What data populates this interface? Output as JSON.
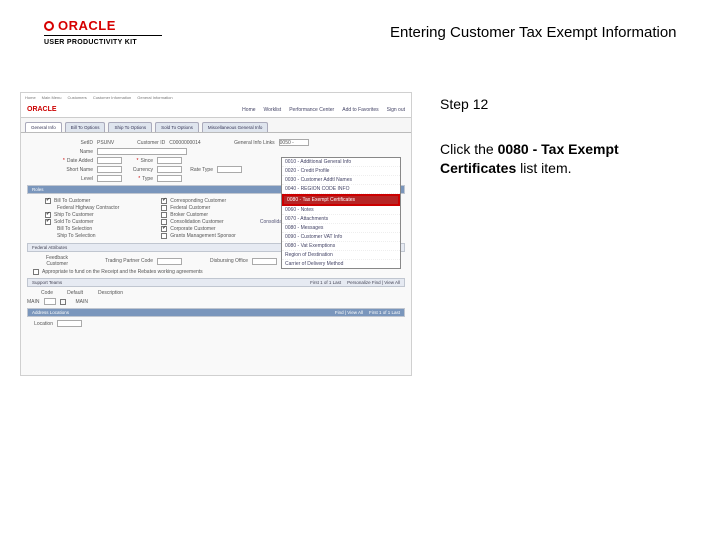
{
  "header": {
    "brand": "ORACLE",
    "subbrand": "USER PRODUCTIVITY KIT",
    "title": "Entering Customer Tax Exempt Information"
  },
  "instructions": {
    "step_label": "Step 12",
    "line_prefix": "Click the ",
    "line_bold": "0080 - Tax Exempt Certificates",
    "line_suffix": " list item."
  },
  "screenshot": {
    "nav_items": [
      "Home",
      "Main Menu",
      "Customers",
      "Customer Information",
      "General Information"
    ],
    "brand": "ORACLE",
    "top_menu": [
      "Home",
      "Worklist",
      "Performance Center",
      "Add to Favorites",
      "Sign out"
    ],
    "tabs": [
      "General Info",
      "Bill To Options",
      "Ship To Options",
      "Sold To Options",
      "Miscellaneous General Info"
    ],
    "fields": {
      "setid_label": "SetID",
      "setid_value": "PSUNV",
      "custid_label": "Customer ID",
      "custid_value": "C0000000014",
      "name_label": "Name",
      "date_added_label": "Date Added",
      "since_label": "Since",
      "type_label": "Type",
      "short_label": "Short Name",
      "currency_label": "Currency",
      "rtype_label": "Rate Type",
      "level_label": "Level",
      "roles_header": "Roles",
      "rig_label": "Bill To Customer",
      "rig2": "Corresponding Customer",
      "rig3": "Federal Highway Contractor",
      "rig4": "Broker Customer",
      "sold_label": "Sold To Customer",
      "consolidation_label": "Consolidation Customer",
      "corporate_label": "Corporate Customer",
      "grants_label": "Grants Management Sponsor",
      "consol_bu": "Consolidation Business Unit",
      "ap_header": "Federal Attributes",
      "tps_label": "Trading Partner Code",
      "disb_label": "Disbursing Office",
      "seq_label": "Appropriate to fund on the Receipt and the Rebates working agreements",
      "supp_header": "Support Teams",
      "code_col": "Code",
      "default_col": "Default",
      "desc_col": "Description",
      "pers_header": "Personalize  Find | View All",
      "addr_header": "Address Locations",
      "addr_find": "Find | View All",
      "addr_range": "First  1 of 1  Last",
      "addr_loc": "Location"
    },
    "dropdown": {
      "group_label": "General Info Links",
      "dd_value": "0050 -",
      "items_before": [
        "0010 - Additional General Info",
        "0020 - Credit Profile",
        "0030 - Customer Addtl Names",
        "0040 - REGION CODE INFO"
      ],
      "highlight": "0080 - Tax Exempt Certificates",
      "items_after": [
        "0060 - Notes",
        "0070 - Attachments",
        "0080 - Messages",
        "0090 - Customer VAT Info",
        "0080 - Vat Exemptions",
        "Region of Destination",
        "Carrier of Delivery Method"
      ]
    }
  }
}
